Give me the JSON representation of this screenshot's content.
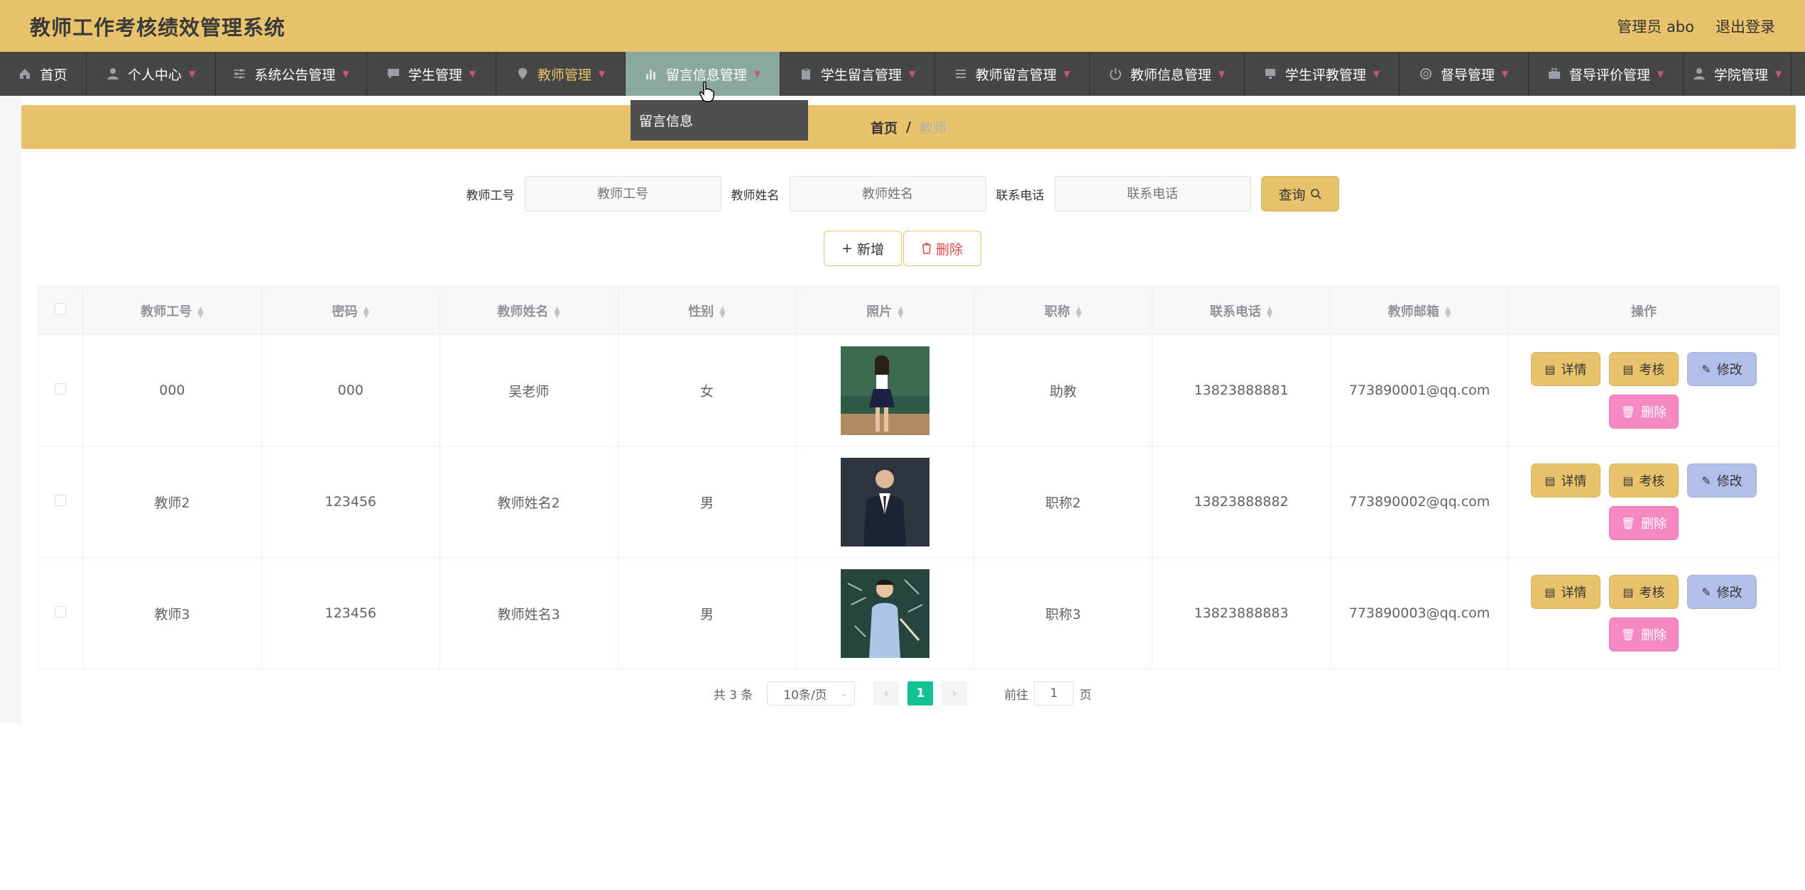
{
  "header": {
    "title": "教师工作考核绩效管理系统",
    "user": "管理员 abo",
    "logout": "退出登录"
  },
  "nav": {
    "items": [
      {
        "label": "首页",
        "icon": "home-icon"
      },
      {
        "label": "个人中心",
        "icon": "person-icon"
      },
      {
        "label": "系统公告管理",
        "icon": "sliders-icon"
      },
      {
        "label": "学生管理",
        "icon": "chat-icon"
      },
      {
        "label": "教师管理",
        "icon": "location-icon"
      },
      {
        "label": "留言信息管理",
        "icon": "bar-chart-icon"
      },
      {
        "label": "学生留言管理",
        "icon": "clipboard-icon"
      },
      {
        "label": "教师留言管理",
        "icon": "list-icon"
      },
      {
        "label": "教师信息管理",
        "icon": "power-icon"
      },
      {
        "label": "学生评教管理",
        "icon": "monitor-icon"
      },
      {
        "label": "督导管理",
        "icon": "help-circle-icon"
      },
      {
        "label": "督导评价管理",
        "icon": "suitcase-icon"
      },
      {
        "label": "学院管理",
        "icon": "user-icon"
      }
    ],
    "dropdown_item": "留言信息"
  },
  "breadcrumb": {
    "home": "首页",
    "separator": "/",
    "current": "教师"
  },
  "search": {
    "fields": [
      {
        "label": "教师工号",
        "placeholder": "教师工号"
      },
      {
        "label": "教师姓名",
        "placeholder": "教师姓名"
      },
      {
        "label": "联系电话",
        "placeholder": "联系电话"
      }
    ],
    "button": "查询"
  },
  "actions": {
    "add": "新增",
    "delete": "删除"
  },
  "table": {
    "columns": [
      "教师工号",
      "密码",
      "教师姓名",
      "性别",
      "照片",
      "职称",
      "联系电话",
      "教师邮箱",
      "操作"
    ],
    "rows": [
      {
        "id": "000",
        "password": "000",
        "name": "吴老师",
        "gender": "女",
        "title": "助教",
        "phone": "13823888881",
        "email": "773890001@qq.com"
      },
      {
        "id": "教师2",
        "password": "123456",
        "name": "教师姓名2",
        "gender": "男",
        "title": "职称2",
        "phone": "13823888882",
        "email": "773890002@qq.com"
      },
      {
        "id": "教师3",
        "password": "123456",
        "name": "教师姓名3",
        "gender": "男",
        "title": "职称3",
        "phone": "13823888883",
        "email": "773890003@qq.com"
      }
    ],
    "ops": {
      "detail": "详情",
      "review": "考核",
      "edit": "修改",
      "remove": "删除"
    }
  },
  "pagination": {
    "total": "共 3 条",
    "page_size": "10条/页",
    "current_page": "1",
    "goto_prefix": "前往",
    "goto_value": "1",
    "goto_suffix": "页"
  },
  "colors": {
    "accent": "#e8c36b",
    "nav_bg": "#464646",
    "active_nav": "#8aa7a0",
    "page_active": "#13c293",
    "edit_btn": "#b3bfe8",
    "remove_btn": "#f58ac3"
  }
}
